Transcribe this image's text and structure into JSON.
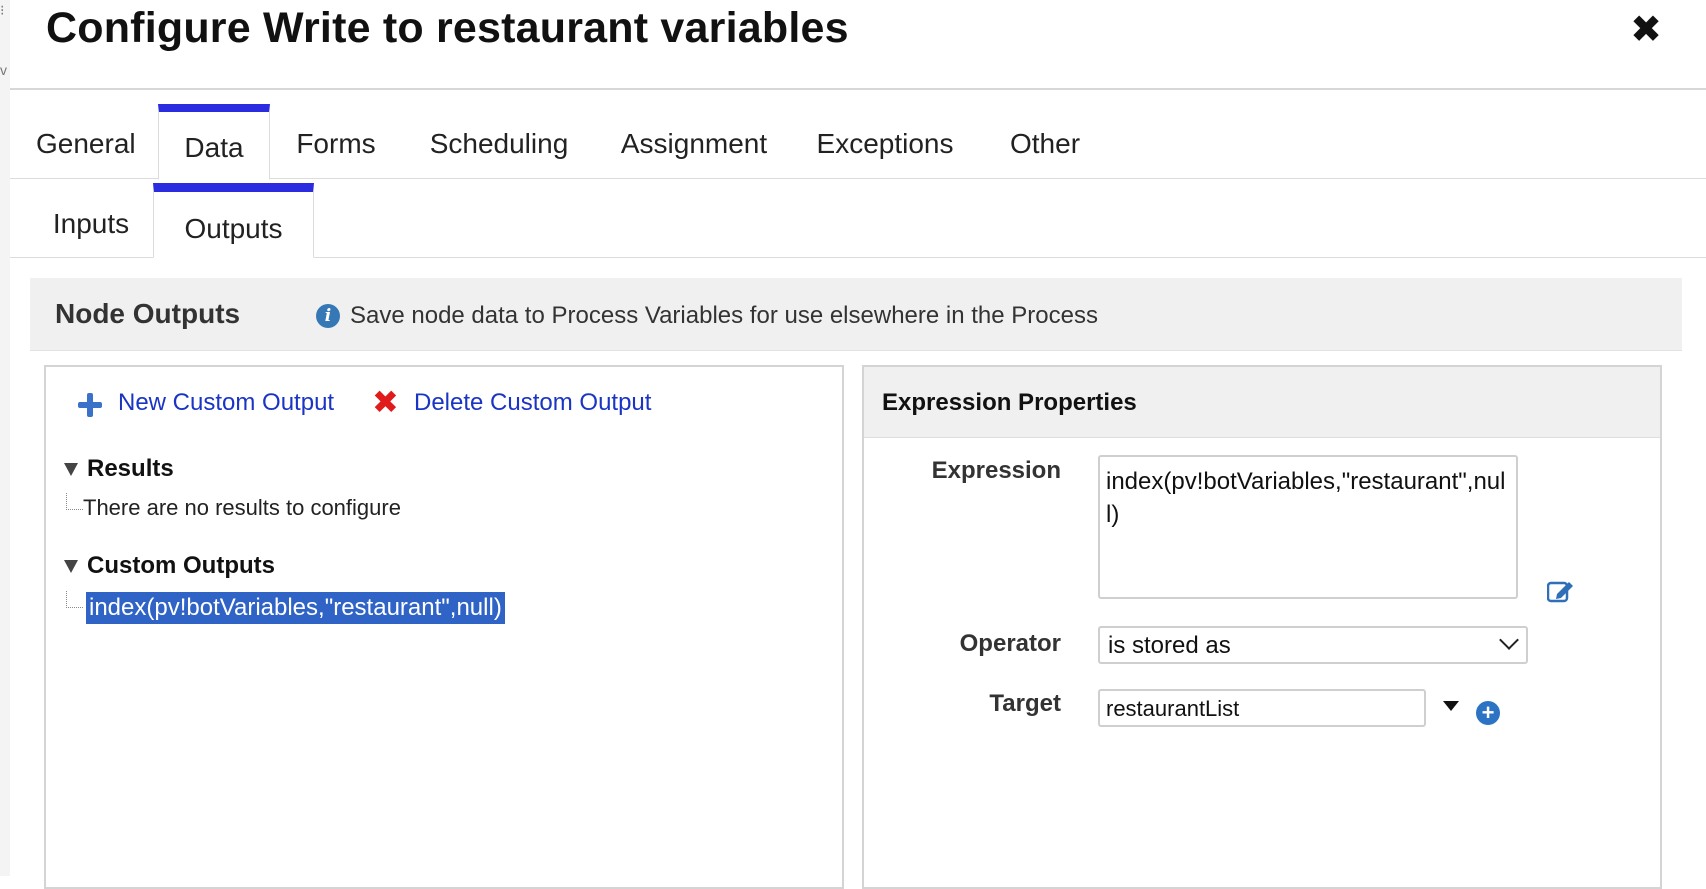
{
  "dialog": {
    "title": "Configure Write to restaurant variables",
    "close_icon": "close-icon"
  },
  "tabs": [
    {
      "label": "General"
    },
    {
      "label": "Data",
      "active": true
    },
    {
      "label": "Forms"
    },
    {
      "label": "Scheduling"
    },
    {
      "label": "Assignment"
    },
    {
      "label": "Exceptions"
    },
    {
      "label": "Other"
    }
  ],
  "subtabs": [
    {
      "label": "Inputs"
    },
    {
      "label": "Outputs",
      "active": true
    }
  ],
  "node_outputs": {
    "title": "Node Outputs",
    "info_icon": "info-icon",
    "description": "Save node data to Process Variables for use elsewhere in the Process"
  },
  "left_panel": {
    "new_output_label": "New Custom Output",
    "delete_output_label": "Delete Custom Output",
    "results_heading": "Results",
    "results_empty": "There are no results to configure",
    "custom_outputs_heading": "Custom Outputs",
    "custom_output_items": [
      "index(pv!botVariables,\"restaurant\",null)"
    ]
  },
  "expression_properties": {
    "heading": "Expression Properties",
    "expression_label": "Expression",
    "expression_value": "index(pv!botVariables,\"restaurant\",null)",
    "operator_label": "Operator",
    "operator_value": "is stored as",
    "target_label": "Target",
    "target_value": "restaurantList"
  },
  "colors": {
    "tab_accent": "#2b2be0",
    "link": "#1a35c4",
    "selection": "#2f63c5",
    "delete_icon": "#e01b1b",
    "info_icon": "#3578b5"
  }
}
